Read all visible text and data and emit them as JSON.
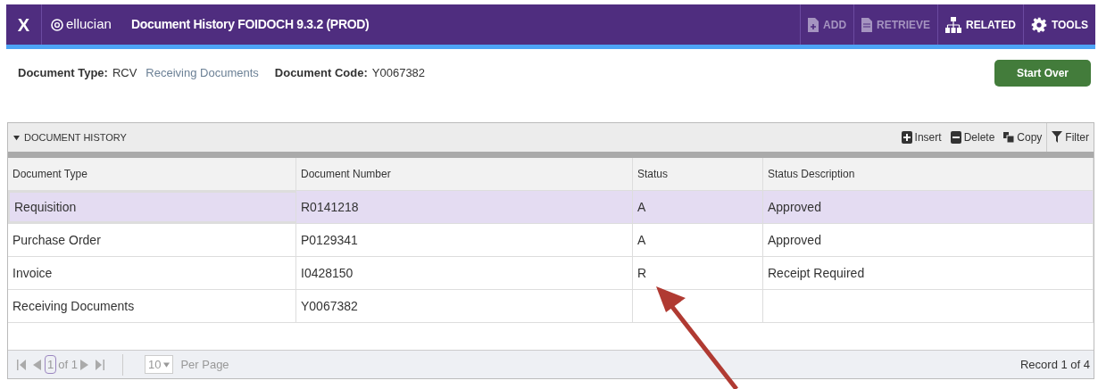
{
  "app_bar": {
    "close": "X",
    "brand": "ellucian",
    "title": "Document History FOIDOCH 9.3.2 (PROD)",
    "actions": [
      {
        "kind": "add",
        "label": "ADD",
        "disabled": true
      },
      {
        "kind": "retrieve",
        "label": "RETRIEVE",
        "disabled": true
      },
      {
        "kind": "related",
        "label": "RELATED",
        "disabled": false
      },
      {
        "kind": "tools",
        "label": "TOOLS",
        "disabled": false
      }
    ]
  },
  "key_block": {
    "type_label": "Document Type:",
    "type_code": "RCV",
    "type_desc": "Receiving Documents",
    "code_label": "Document Code:",
    "code_value": "Y0067382",
    "start_over": "Start Over"
  },
  "section": {
    "title": "DOCUMENT HISTORY",
    "expanded": true,
    "tools": [
      {
        "kind": "insert",
        "label": "Insert"
      },
      {
        "kind": "delete",
        "label": "Delete"
      },
      {
        "kind": "copy",
        "label": "Copy"
      },
      {
        "kind": "filter",
        "label": "Filter"
      }
    ]
  },
  "table": {
    "columns": [
      "Document Type",
      "Document Number",
      "Status",
      "Status Description"
    ],
    "rows": [
      {
        "cells": [
          "Requisition",
          "R0141218",
          "A",
          "Approved"
        ],
        "selected": true
      },
      {
        "cells": [
          "Purchase Order",
          "P0129341",
          "A",
          "Approved"
        ],
        "selected": false
      },
      {
        "cells": [
          "Invoice",
          "I0428150",
          "R",
          "Receipt Required"
        ],
        "selected": false
      },
      {
        "cells": [
          "Receiving Documents",
          "Y0067382",
          "",
          ""
        ],
        "selected": false
      }
    ]
  },
  "pager": {
    "page": "1",
    "of": "of 1",
    "per_page": "10",
    "per_page_label": "Per Page",
    "record": "Record 1 of 4"
  }
}
